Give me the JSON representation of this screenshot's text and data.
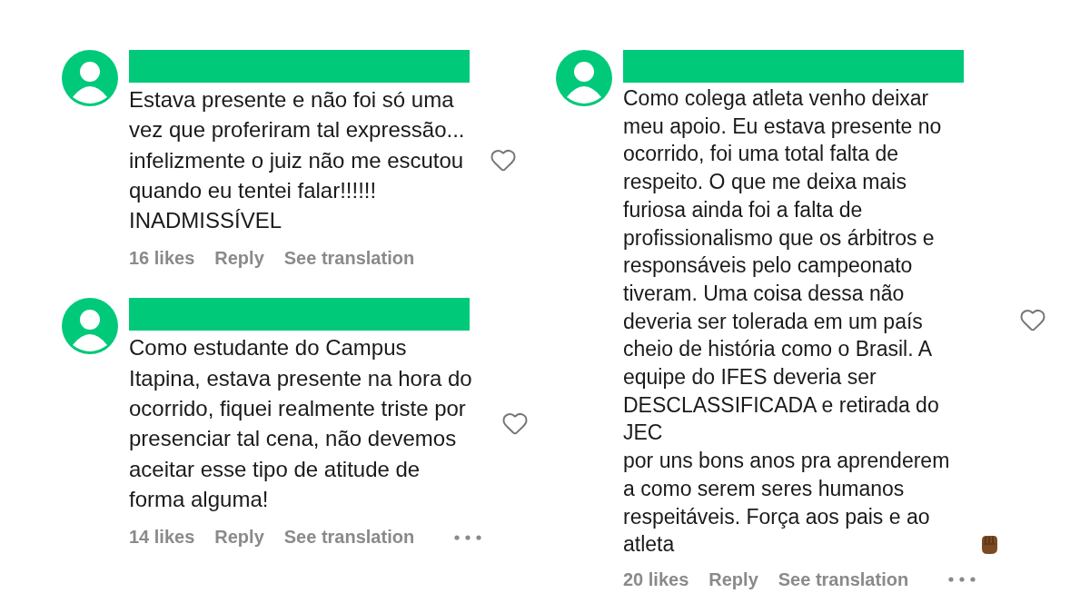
{
  "columns": [
    {
      "comments": [
        {
          "text": "Estava presente e não foi só uma\nvez que proferiram tal expressão...\ninfelizmente o juiz não me escutou\nquando eu tentei falar!!!!!!\nINADMISSÍVEL",
          "emoji": false,
          "likes": "16 likes",
          "reply": "Reply",
          "translation": "See translation",
          "more": false
        },
        {
          "text": "Como estudante do Campus\nItapina, estava presente na hora do\nocorrido, fiquei realmente triste por\npresenciar tal cena, não devemos\naceitar esse tipo de atitude de\nforma alguma!",
          "emoji": false,
          "likes": "14 likes",
          "reply": "Reply",
          "translation": "See translation",
          "more": true
        }
      ]
    },
    {
      "comments": [
        {
          "text": "Como colega atleta venho deixar\nmeu apoio. Eu estava presente no\nocorrido, foi uma total falta de\nrespeito. O que me deixa mais\nfuriosa ainda foi a falta de\nprofissionalismo que os árbitros e\nresponsáveis pelo campeonato\ntiveram. Uma coisa dessa não\ndeveria ser tolerada em um país\ncheio de história como o Brasil. A\nequipe do IFES deveria ser\nDESCLASSIFICADA e retirada do JEC\npor uns bons anos pra aprenderem\na como serem seres humanos\nrespeitáveis. Força aos pais e ao\natleta",
          "emoji": true,
          "likes": "20 likes",
          "reply": "Reply",
          "translation": "See translation",
          "more": true
        }
      ]
    }
  ]
}
